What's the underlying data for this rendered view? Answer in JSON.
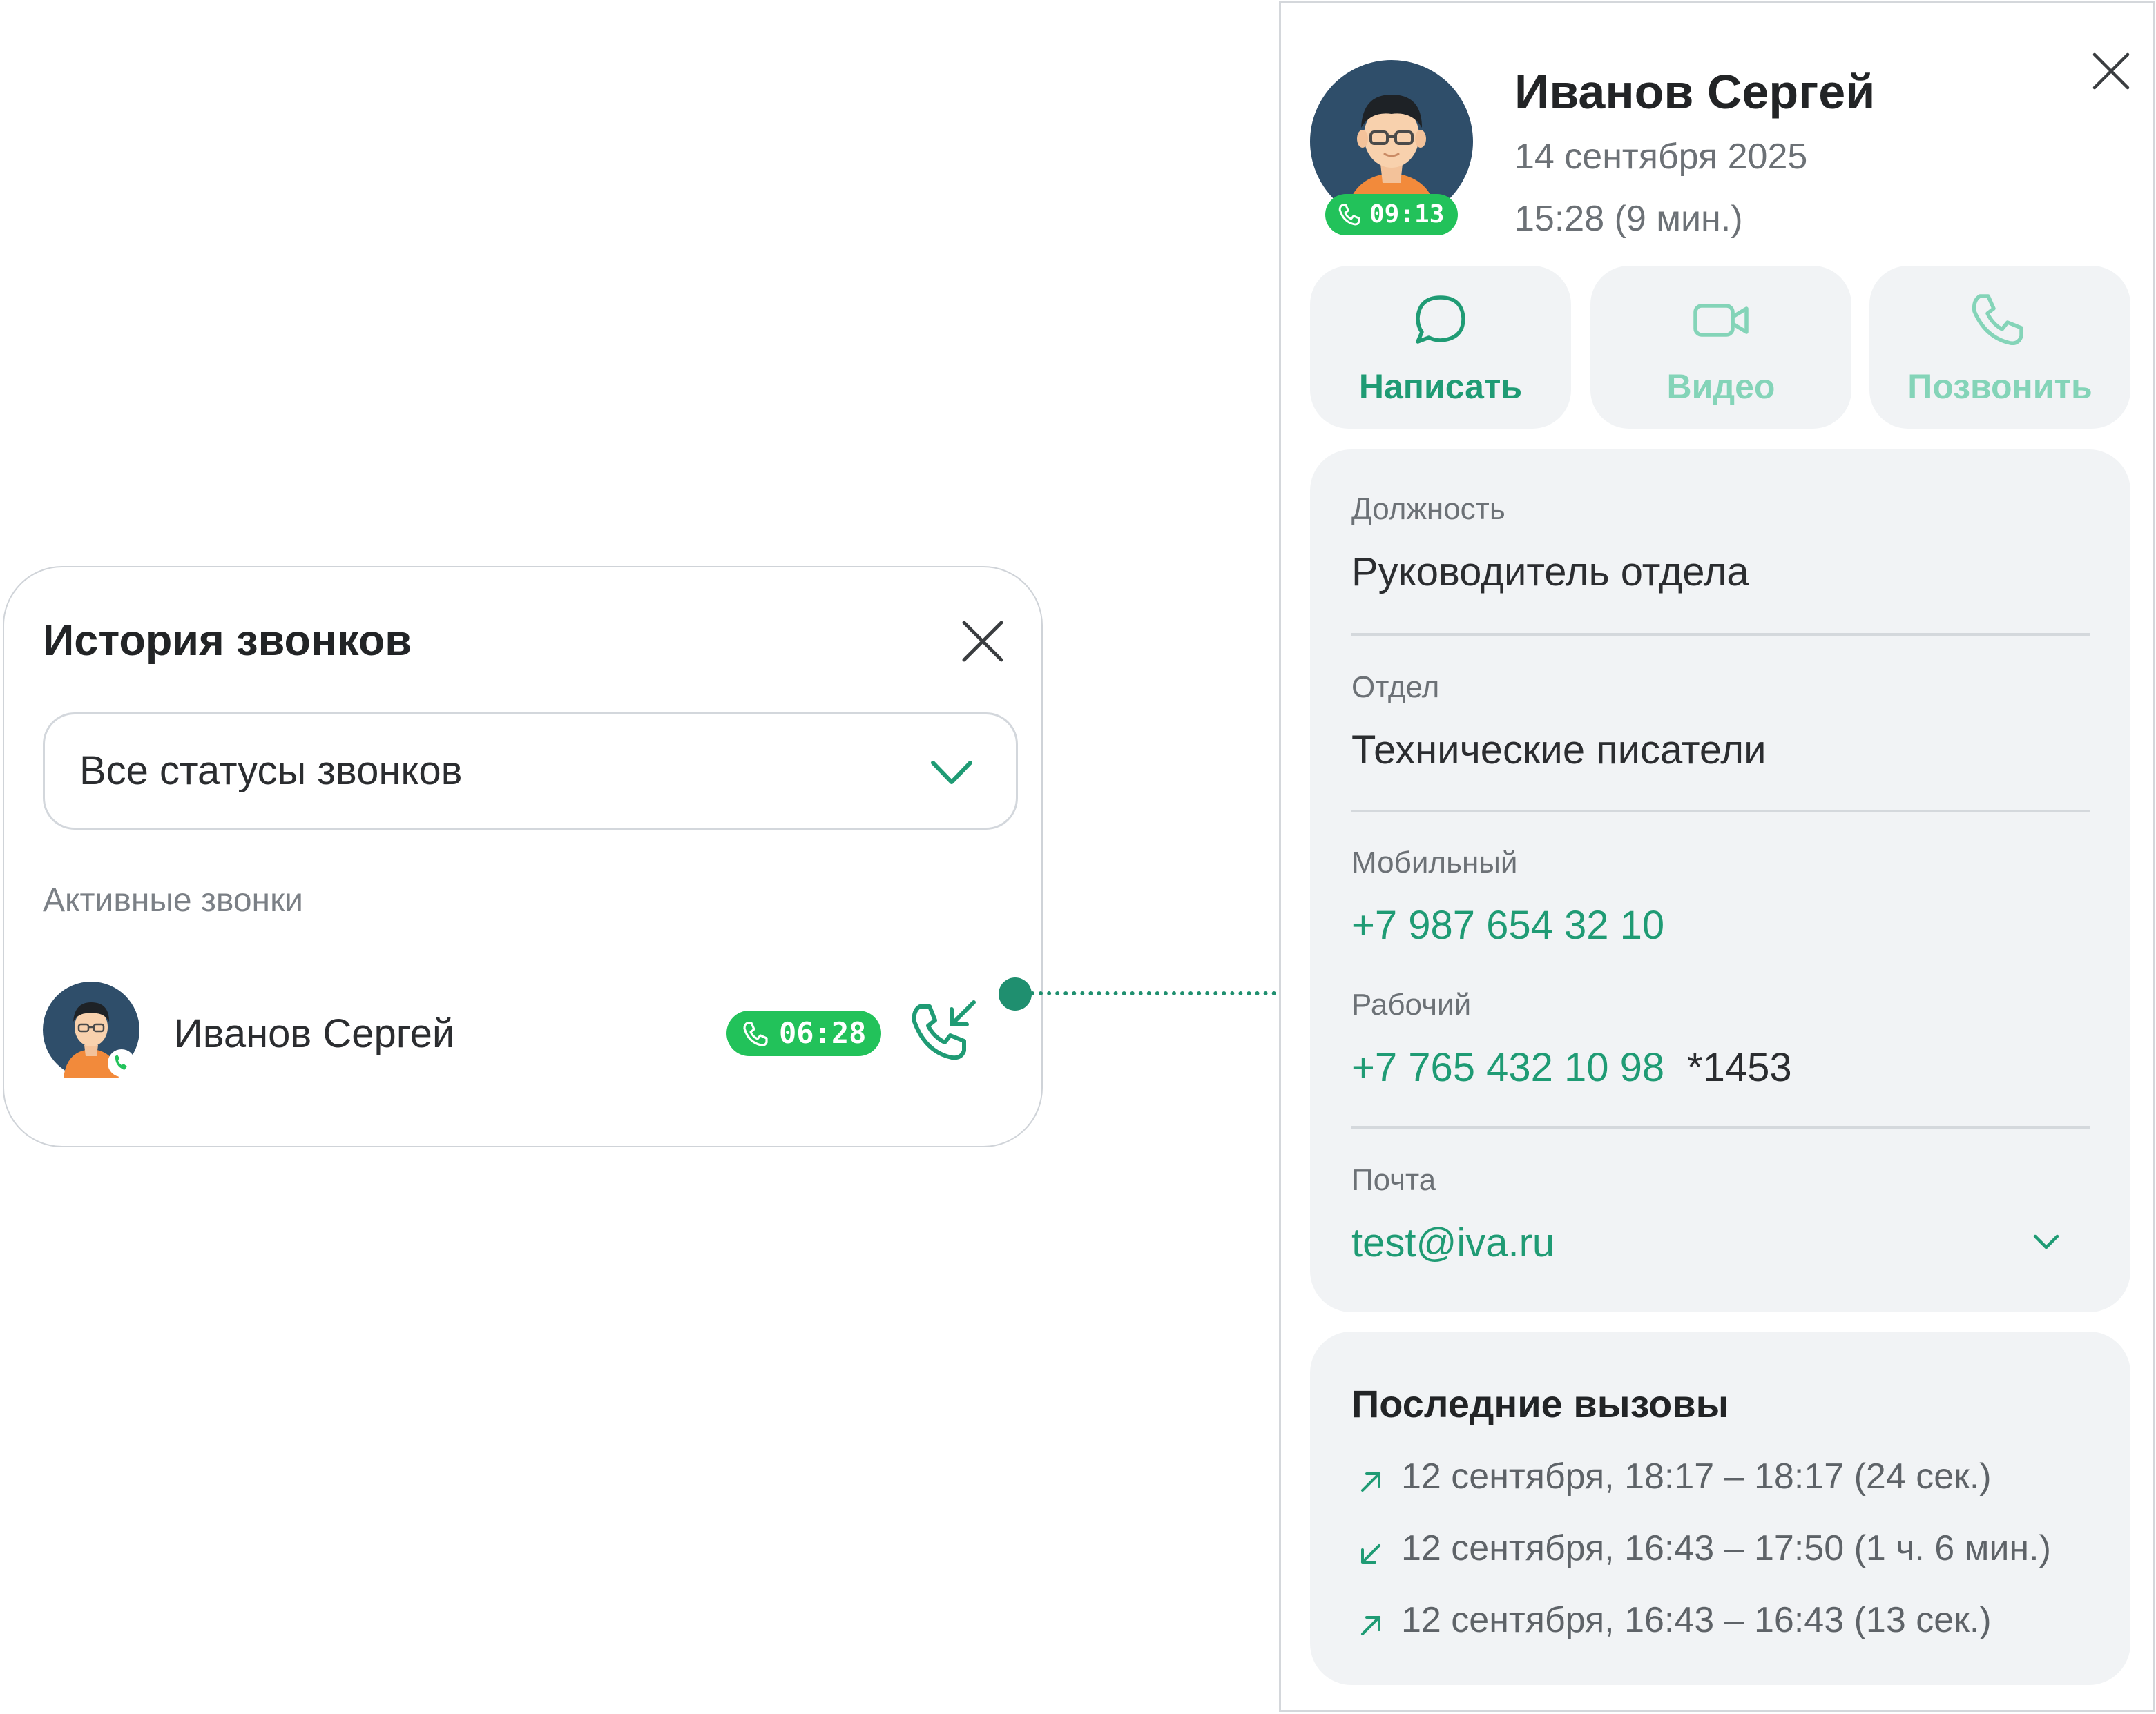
{
  "colors": {
    "accent_green": "#1f9b74",
    "accent_light": "#84d4b8",
    "timer_green": "#22c25a",
    "panel_bg": "#f1f3f5"
  },
  "history": {
    "title": "История звонков",
    "close_icon": "close-icon",
    "filter": {
      "selected": "Все статусы звонков",
      "icon": "chevron-down-icon"
    },
    "section_label": "Активные звонки",
    "active_calls": [
      {
        "name": "Иванов Сергей",
        "timer": "06:28",
        "direction_icon": "incoming-call-icon"
      }
    ]
  },
  "contact": {
    "name": "Иванов Сергей",
    "date": "14 сентября 2025",
    "time": "15:28 (9 мин.)",
    "avatar_timer": "09:13",
    "actions": [
      {
        "label": "Написать",
        "icon": "chat-bubble-icon"
      },
      {
        "label": "Видео",
        "icon": "video-camera-icon"
      },
      {
        "label": "Позвонить",
        "icon": "phone-icon"
      }
    ],
    "fields": {
      "position": {
        "label": "Должность",
        "value": "Руководитель отдела"
      },
      "department": {
        "label": "Отдел",
        "value": "Технические писатели"
      },
      "mobile": {
        "label": "Мобильный",
        "value": "+7 987 654 32 10"
      },
      "work": {
        "label": "Рабочий",
        "value": "+7 765 432 10 98",
        "ext": "*1453"
      },
      "email": {
        "label": "Почта",
        "value": "test@iva.ru"
      }
    },
    "recent_calls": {
      "title": "Последние вызовы",
      "items": [
        {
          "direction": "outgoing",
          "text": "12 сентября, 18:17 – 18:17 (24 сек.)"
        },
        {
          "direction": "incoming",
          "text": "12 сентября, 16:43 – 17:50 (1 ч. 6 мин.)"
        },
        {
          "direction": "outgoing",
          "text": "12 сентября, 16:43 – 16:43 (13 сек.)"
        }
      ]
    }
  }
}
